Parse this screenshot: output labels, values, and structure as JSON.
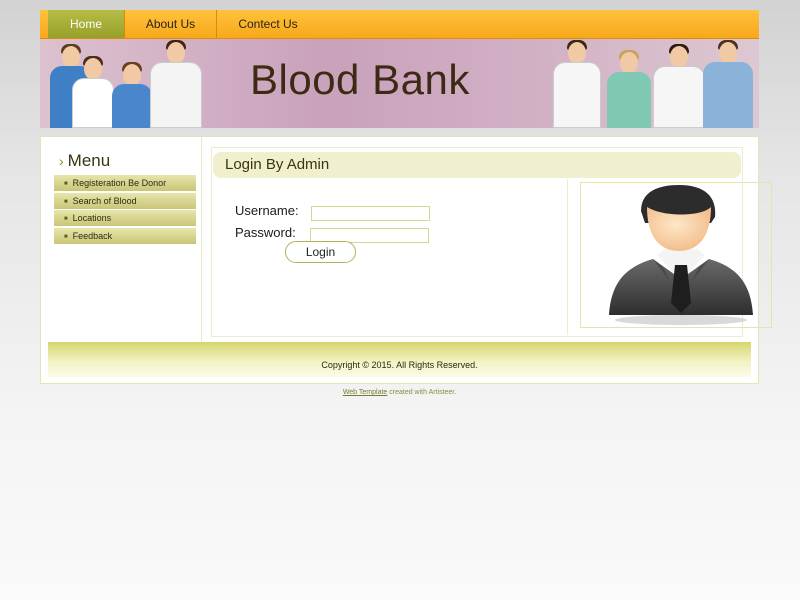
{
  "nav": {
    "items": [
      {
        "label": "Home",
        "active": true
      },
      {
        "label": "About Us",
        "active": false
      },
      {
        "label": "Contect Us",
        "active": false
      }
    ]
  },
  "header": {
    "title": "Blood Bank",
    "banner": "doctors-group-image"
  },
  "sidebar": {
    "title": "Menu",
    "items": [
      {
        "label": "Registeration Be Donor"
      },
      {
        "label": "Search of Blood"
      },
      {
        "label": "Locations"
      },
      {
        "label": "Feedback"
      }
    ]
  },
  "main": {
    "heading": "Login By Admin",
    "username_label": "Username:",
    "username_value": "",
    "password_label": "Password:",
    "password_value": "",
    "login_button": "Login",
    "avatar_icon": "admin-user-avatar-icon"
  },
  "footer": {
    "copyright": "Copyright © 2015. All Rights Reserved.",
    "credit_link": "Web Template",
    "credit_text": "created with Artisteer."
  },
  "colors": {
    "nav_bg": "#f7a81b",
    "nav_active": "#a0a830",
    "title_text": "#3c2a14",
    "menu_item_bg": "#d6d38e",
    "heading_bg": "#f0f0cf"
  }
}
